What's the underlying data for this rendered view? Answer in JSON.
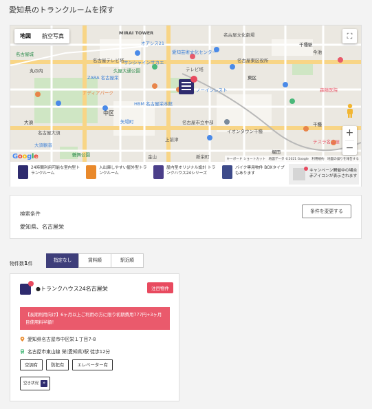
{
  "page": {
    "title": "愛知県のトランクルームを探す"
  },
  "map": {
    "type_buttons": [
      "地図",
      "航空写真"
    ],
    "google_logo": "Google",
    "footer": [
      "キーボード ショートカット",
      "地図データ ©2021 Google",
      "利用規約",
      "地図の誤りを報告する"
    ],
    "zoom_in": "+",
    "zoom_out": "−",
    "labels": [
      "MIRAI TOWER",
      "オアシス21",
      "愛知芸術文化センター",
      "名古屋文化劇場",
      "名古屋テレビ塔",
      "久屋大通公園",
      "名古屋城",
      "丸の内",
      "ナディアパーク",
      "中区",
      "矢場町",
      "HBM 名古屋栄本館",
      "名古屋市立中部",
      "イオンタウン千種",
      "千種",
      "上前津",
      "大須観音",
      "鶴舞公園",
      "テレビ塔",
      "サンシャインサカエ",
      "ZARA 名古屋栄",
      "東区",
      "名古屋大須",
      "大須",
      "堀田",
      "新栄町",
      "金山",
      "ノーインレスト",
      "森精医院",
      "テスラ名古屋",
      "千種駅",
      "今池",
      "名古屋東区役所"
    ]
  },
  "legend": {
    "items": [
      "24時間利用可能な室内型トランクルーム",
      "入出庫しやすい屋外型トランクルーム",
      "屋内型オリジナル設計 トランクハウス24シリーズ",
      "バイク専用物件 BOXタイプもあります"
    ],
    "campaign": "キャンペーン開催中の場合 赤アイコンが表示されます"
  },
  "search": {
    "label": "検索条件",
    "value": "愛知県、名古屋栄",
    "change_button": "条件を変更する"
  },
  "results": {
    "count_prefix": "物件数",
    "count": "1",
    "count_suffix": "件",
    "sort_options": [
      "指定なし",
      "賃料順",
      "駅近順"
    ]
  },
  "listing": {
    "name": "●トランクハウス24名古屋栄",
    "badge": "注目物件",
    "promo": "【長期利用向け】6ヶ月以上ご利用の方に限り初期費用777円+3ヶ月目使用料半額！",
    "address": "愛知県名古屋市中区栄１丁目7-8",
    "station": "名古屋市東山線 栄(愛知県)駅 徒歩12分",
    "tags": [
      "空調有",
      "防犯有",
      "エレベーター有"
    ],
    "vacancy": "空き状況"
  },
  "colors": {
    "navy": "#2e2b6e",
    "accent_red": "#e84a5f",
    "orange": "#e9892b",
    "sort_active": "#3e3e7a"
  }
}
